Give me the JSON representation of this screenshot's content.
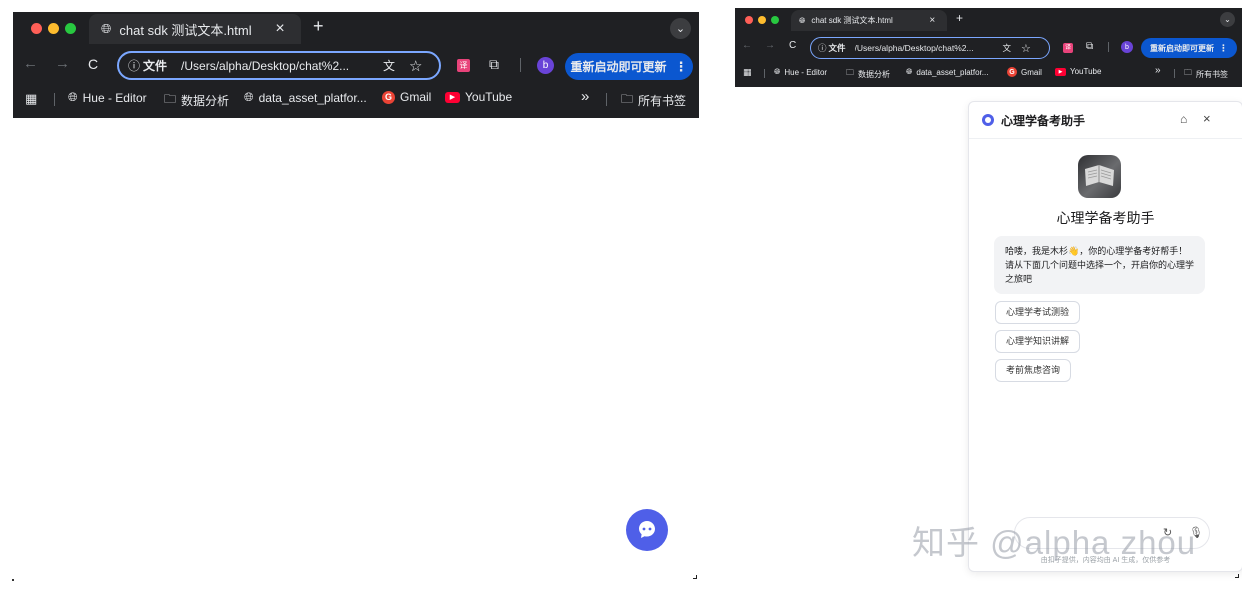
{
  "browser": {
    "tab_title": "chat sdk 测试文本.html",
    "tab_close": "×",
    "new_tab": "+",
    "tab_menu": "⌄",
    "nav": {
      "back": "←",
      "forward": "→",
      "reload": "C"
    },
    "address": {
      "scheme_icon": "ⓘ",
      "scheme_label": "文件",
      "url": "/Users/alpha/Desktop/chat%2..."
    },
    "relaunch_label": "重新启动即可更新",
    "menu": "⋮",
    "profile_initial": "b",
    "bookmarks": [
      {
        "label": "Hue - Editor",
        "icon": "globe-icon"
      },
      {
        "label": "数据分析",
        "icon": "folder-icon"
      },
      {
        "label": "data_asset_platfor...",
        "icon": "globe-icon"
      },
      {
        "label": "Gmail",
        "icon": "google-icon"
      },
      {
        "label": "YouTube",
        "icon": "youtube-icon"
      }
    ],
    "bookmarks_more": "»",
    "all_bookmarks": "所有书签"
  },
  "chat": {
    "header_title": "心理学备考助手",
    "bot_name": "心理学备考助手",
    "greeting": "哈喽，我是木杉👋，你的心理学备考好帮手！请从下面几个问题中选择一个，开启你的心理学之旅吧",
    "suggestions": [
      "心理学考试测验",
      "心理学知识讲解",
      "考前焦虑咨询"
    ],
    "footer": "由扣子提供，内容均由 AI 生成，仅供参考"
  },
  "watermark": "知乎 @alpha zhou",
  "colors": {
    "chrome_bg": "#1f2023",
    "tab_bg": "#2d2e31",
    "accent": "#0b57d0",
    "chat_fab": "#4f5fe8"
  }
}
